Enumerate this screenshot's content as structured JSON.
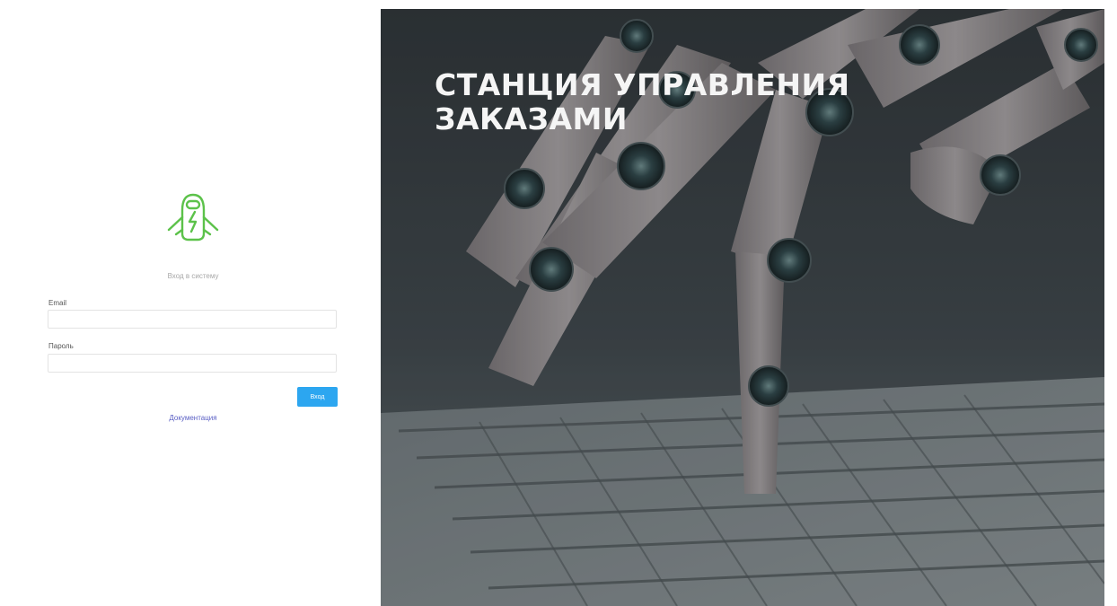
{
  "login": {
    "title": "Вход в систему",
    "email_label": "Email",
    "email_value": "",
    "password_label": "Пароль",
    "password_value": "",
    "submit_label": "Вход",
    "docs_link": "Документация"
  },
  "hero": {
    "title_line1": "СТАНЦИЯ УПРАВЛЕНИЯ",
    "title_line2": "ЗАКАЗАМИ"
  },
  "colors": {
    "accent_button": "#2ca6f0",
    "link": "#5a5fc4",
    "logo_green": "#5cc24a",
    "hero_background": "#3e4449"
  },
  "icons": {
    "logo": "robot-battery-logo"
  }
}
